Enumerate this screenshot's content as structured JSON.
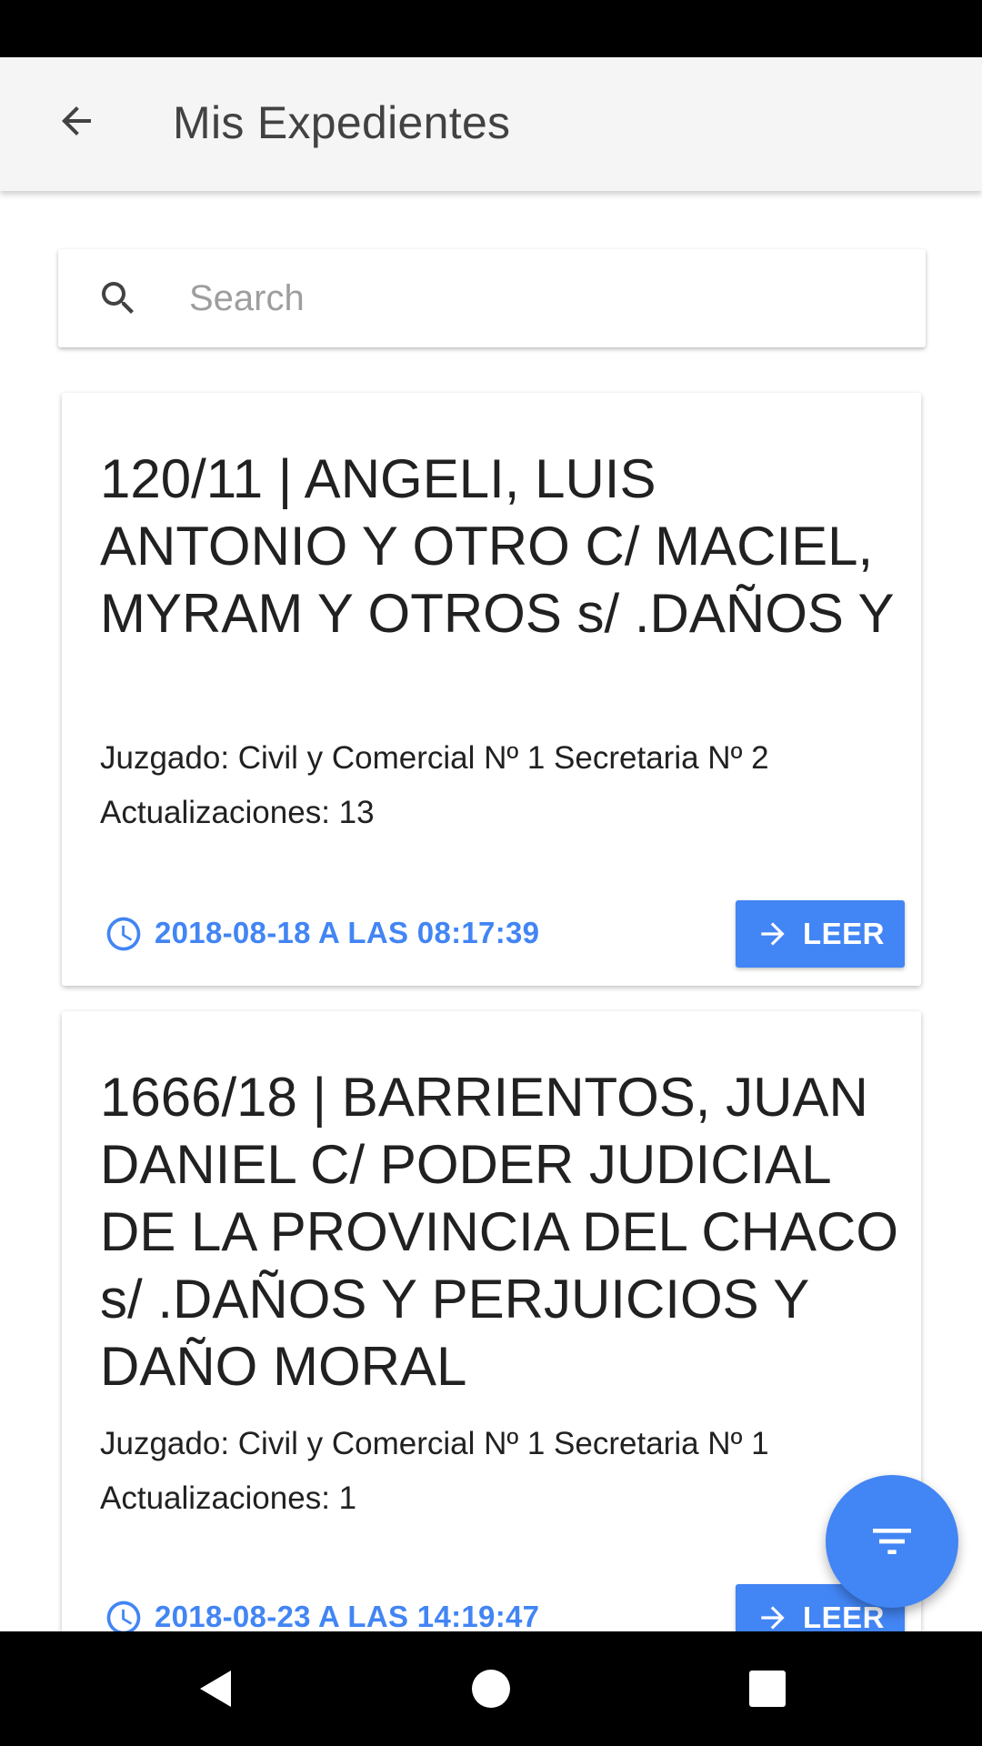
{
  "header": {
    "title": "Mis Expedientes",
    "back_icon": "arrow-back-icon"
  },
  "search": {
    "placeholder": "Search",
    "value": "",
    "icon": "search-icon"
  },
  "cases": [
    {
      "title": "120/11 | ANGELI, LUIS ANTONIO Y OTRO C/ MACIEL, MYRAM Y OTROS s/ .DAÑOS Y",
      "court": "Juzgado: Civil y Comercial Nº 1 Secretaria Nº 2",
      "updates": "Actualizaciones: 13",
      "date": "2018-08-18 A LAS 08:17:39",
      "read_label": "LEER"
    },
    {
      "title": "1666/18 | BARRIENTOS, JUAN DANIEL C/ PODER JUDICIAL DE LA PROVINCIA DEL CHACO s/ .DAÑOS Y PERJUICIOS Y DAÑO MORAL",
      "court": "Juzgado: Civil y Comercial Nº 1 Secretaria Nº 1",
      "updates": "Actualizaciones: 1",
      "date": "2018-08-23 A LAS 14:19:47",
      "read_label": "LEER"
    }
  ],
  "fab": {
    "icon": "filter-icon"
  },
  "colors": {
    "accent": "#4285f4",
    "app_bar": "#f5f5f5",
    "text": "#212121"
  }
}
